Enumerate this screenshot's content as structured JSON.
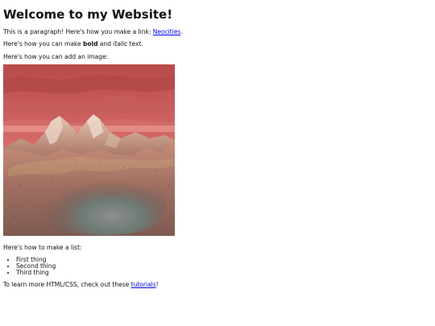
{
  "page": {
    "title": "Welcome to my Website!",
    "paragraph_link": {
      "before": "This is a paragraph! Here's how you make a link: ",
      "link_text": "Neocities",
      "after": "."
    },
    "paragraph_format": {
      "before": "Here's how you can make ",
      "bold_text": "bold",
      "middle": " and ",
      "italic_text": "italic",
      "after": " text."
    },
    "paragraph_image": "Here's how you can add an image:",
    "paragraph_list": "Here's how to make a list:",
    "list_items": [
      "First thing",
      "Second thing",
      "Third thing"
    ],
    "paragraph_learn": {
      "before": "To learn more HTML/CSS, check out these ",
      "link_text": "tutorials",
      "after": "!"
    }
  },
  "colors": {
    "link": "#0000ee",
    "sky": "#c85a5a",
    "terrain": "#a07a6a"
  },
  "icons": {
    "image": "alien-landscape-image"
  }
}
